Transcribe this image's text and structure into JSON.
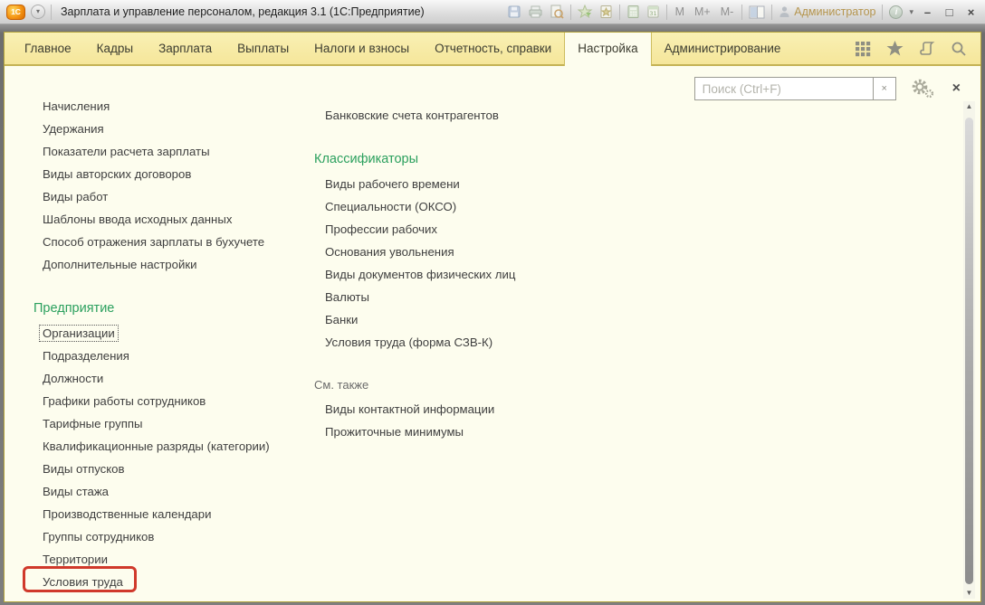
{
  "titlebar": {
    "title": "Зарплата и управление персоналом, редакция 3.1  (1С:Предприятие)",
    "logo_text": "1С",
    "dropdown_glyph": "▾",
    "memory_buttons": [
      "M",
      "M+",
      "M-"
    ],
    "user": "Администратор",
    "info_glyph": "i",
    "window_buttons": {
      "minimize": "–",
      "maximize": "□",
      "close": "×"
    }
  },
  "tabbar": {
    "tabs": [
      {
        "key": "main",
        "label": "Главное",
        "active": false
      },
      {
        "key": "staff",
        "label": "Кадры",
        "active": false
      },
      {
        "key": "salary",
        "label": "Зарплата",
        "active": false
      },
      {
        "key": "payments",
        "label": "Выплаты",
        "active": false
      },
      {
        "key": "taxes",
        "label": "Налоги и взносы",
        "active": false
      },
      {
        "key": "reports",
        "label": "Отчетность, справки",
        "active": false
      },
      {
        "key": "settings",
        "label": "Настройка",
        "active": true
      },
      {
        "key": "administration",
        "label": "Администрирование",
        "active": false
      }
    ]
  },
  "search": {
    "placeholder": "Поиск (Ctrl+F)",
    "clear_glyph": "×",
    "close_glyph": "×"
  },
  "nav": {
    "left_column": [
      {
        "type": "link",
        "label": "Начисления"
      },
      {
        "type": "link",
        "label": "Удержания"
      },
      {
        "type": "link",
        "label": "Показатели расчета зарплаты"
      },
      {
        "type": "link",
        "label": "Виды авторских договоров"
      },
      {
        "type": "link",
        "label": "Виды работ"
      },
      {
        "type": "link",
        "label": "Шаблоны ввода исходных данных"
      },
      {
        "type": "link",
        "label": "Способ отражения зарплаты в бухучете"
      },
      {
        "type": "link",
        "label": "Дополнительные настройки"
      },
      {
        "type": "heading",
        "label": "Предприятие"
      },
      {
        "type": "link",
        "label": "Организации",
        "focused": true
      },
      {
        "type": "link",
        "label": "Подразделения"
      },
      {
        "type": "link",
        "label": "Должности"
      },
      {
        "type": "link",
        "label": "Графики работы сотрудников"
      },
      {
        "type": "link",
        "label": "Тарифные группы"
      },
      {
        "type": "link",
        "label": "Квалификационные разряды (категории)"
      },
      {
        "type": "link",
        "label": "Виды отпусков"
      },
      {
        "type": "link",
        "label": "Виды стажа"
      },
      {
        "type": "link",
        "label": "Производственные календари"
      },
      {
        "type": "link",
        "label": "Группы сотрудников"
      },
      {
        "type": "link",
        "label": "Территории"
      },
      {
        "type": "link",
        "label": "Условия труда",
        "highlighted": true
      }
    ],
    "right_column": [
      {
        "type": "link",
        "label": "Банковские счета контрагентов"
      },
      {
        "type": "heading",
        "label": "Классификаторы"
      },
      {
        "type": "link",
        "label": "Виды рабочего времени"
      },
      {
        "type": "link",
        "label": "Специальности (ОКСО)"
      },
      {
        "type": "link",
        "label": "Профессии рабочих"
      },
      {
        "type": "link",
        "label": "Основания увольнения"
      },
      {
        "type": "link",
        "label": "Виды документов физических лиц"
      },
      {
        "type": "link",
        "label": "Валюты"
      },
      {
        "type": "link",
        "label": "Банки"
      },
      {
        "type": "link",
        "label": "Условия труда (форма СЗВ-К)"
      },
      {
        "type": "subheading",
        "label": "См. также"
      },
      {
        "type": "link",
        "label": "Виды контактной информации"
      },
      {
        "type": "link",
        "label": "Прожиточные минимумы"
      }
    ]
  },
  "colors": {
    "heading_green": "#2ba05e",
    "highlight_red": "#d0392b",
    "tabbar_yellow": "#f5e69a",
    "panel_cream": "#fdfdee",
    "user_gold": "#b5954e"
  }
}
